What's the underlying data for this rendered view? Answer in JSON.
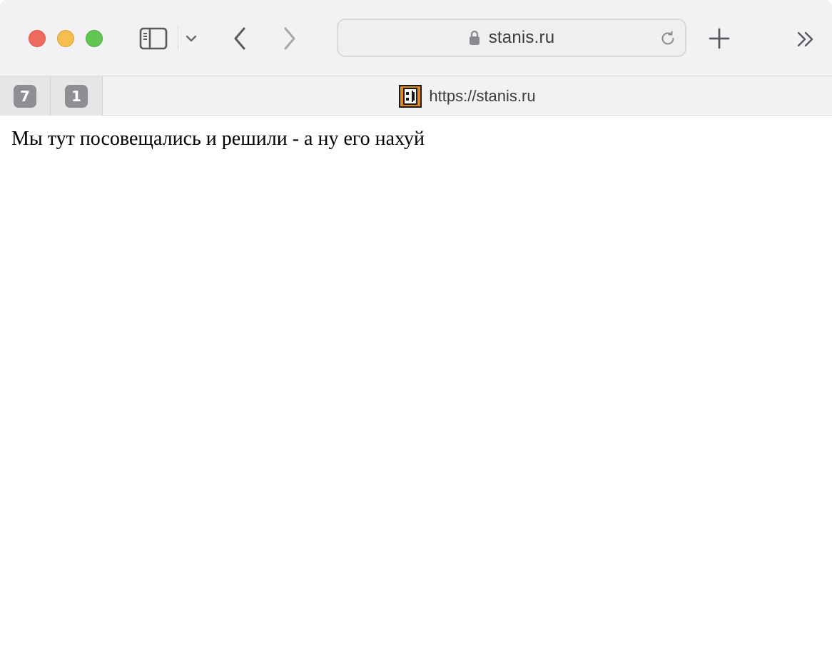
{
  "toolbar": {
    "url": "stanis.ru",
    "icons": {
      "sidebar": "sidebar-icon",
      "tab_group_menu": "chevron-down-icon",
      "back": "chevron-left-icon",
      "forward": "chevron-right-icon",
      "lock": "lock-icon",
      "reload": "reload-icon",
      "new_tab": "plus-icon",
      "more": "double-chevron-right-icon"
    }
  },
  "tabs": {
    "pinned": [
      {
        "label": "7"
      },
      {
        "label": "1"
      }
    ],
    "active": {
      "title": "https://stanis.ru",
      "favicon": "pixel-face-favicon-icon"
    }
  },
  "page": {
    "text": "Мы тут посовещались и решили - а ну его нахуй"
  },
  "colors": {
    "close": "#ee6a5f",
    "minimize": "#f5bf4f",
    "zoom": "#62c655",
    "toolbar_bg": "#f2f2f4",
    "badge_bg": "#8e8e93",
    "favicon_orange": "#e08a1e"
  }
}
